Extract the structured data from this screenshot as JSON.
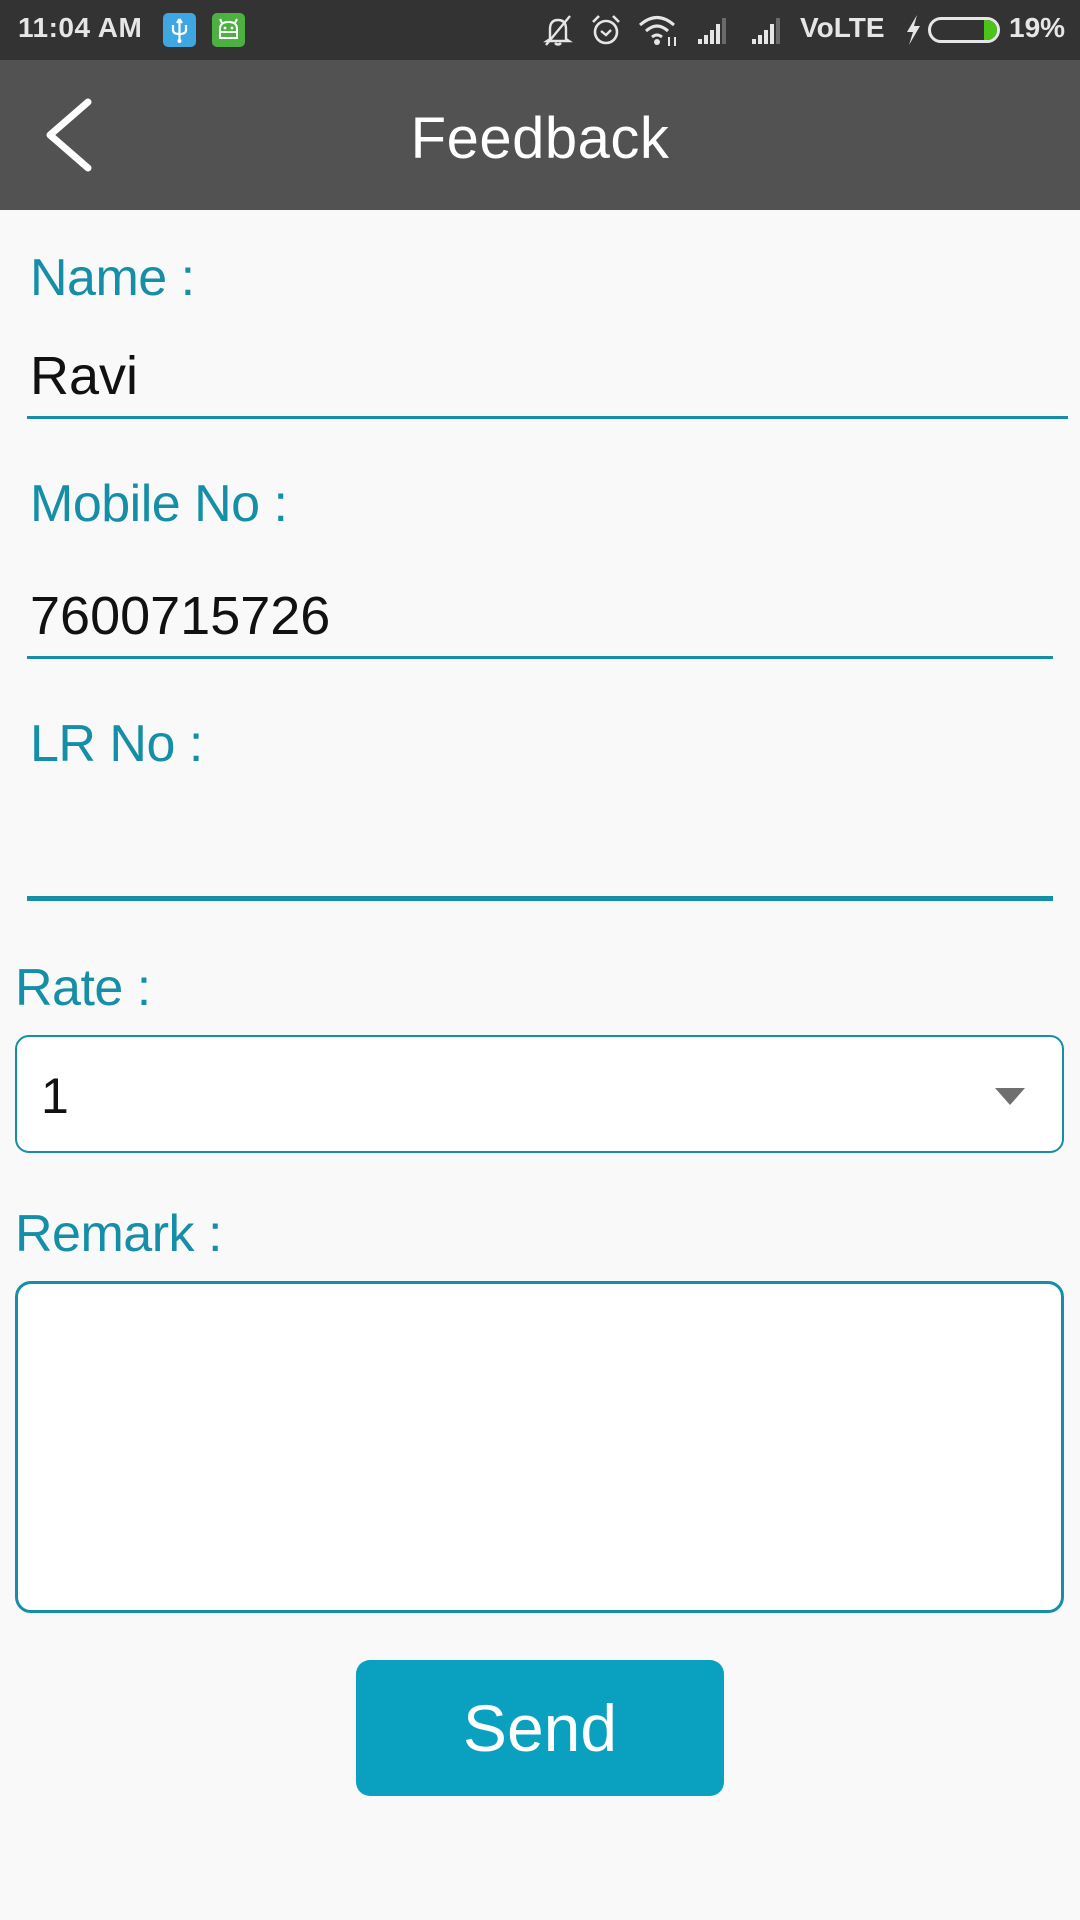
{
  "status_bar": {
    "time": "11:04 AM",
    "notification_icons": [
      "usb-icon",
      "android-icon"
    ],
    "system_icons": [
      "notifications-muted-icon",
      "alarm-icon",
      "wifi-icon",
      "signal-icon",
      "signal-icon"
    ],
    "network_label": "VoLTE",
    "charging": true,
    "battery_percent_label": "19%",
    "battery_level": 0.19
  },
  "app_bar": {
    "title": "Feedback",
    "back_icon": "chevron-left-icon"
  },
  "form": {
    "name": {
      "label": "Name :",
      "value": "Ravi"
    },
    "mobile": {
      "label": "Mobile No :",
      "value": "7600715726"
    },
    "lr_no": {
      "label": "LR No :",
      "value": ""
    },
    "rate": {
      "label": "Rate :",
      "selected": "1"
    },
    "remark": {
      "label": "Remark :",
      "value": ""
    },
    "send_label": "Send"
  },
  "colors": {
    "accent": "#158ea7",
    "button": "#0aa0bf",
    "app_bar": "#525252",
    "status_bar": "#333333",
    "battery_fill": "#4cc21a"
  }
}
